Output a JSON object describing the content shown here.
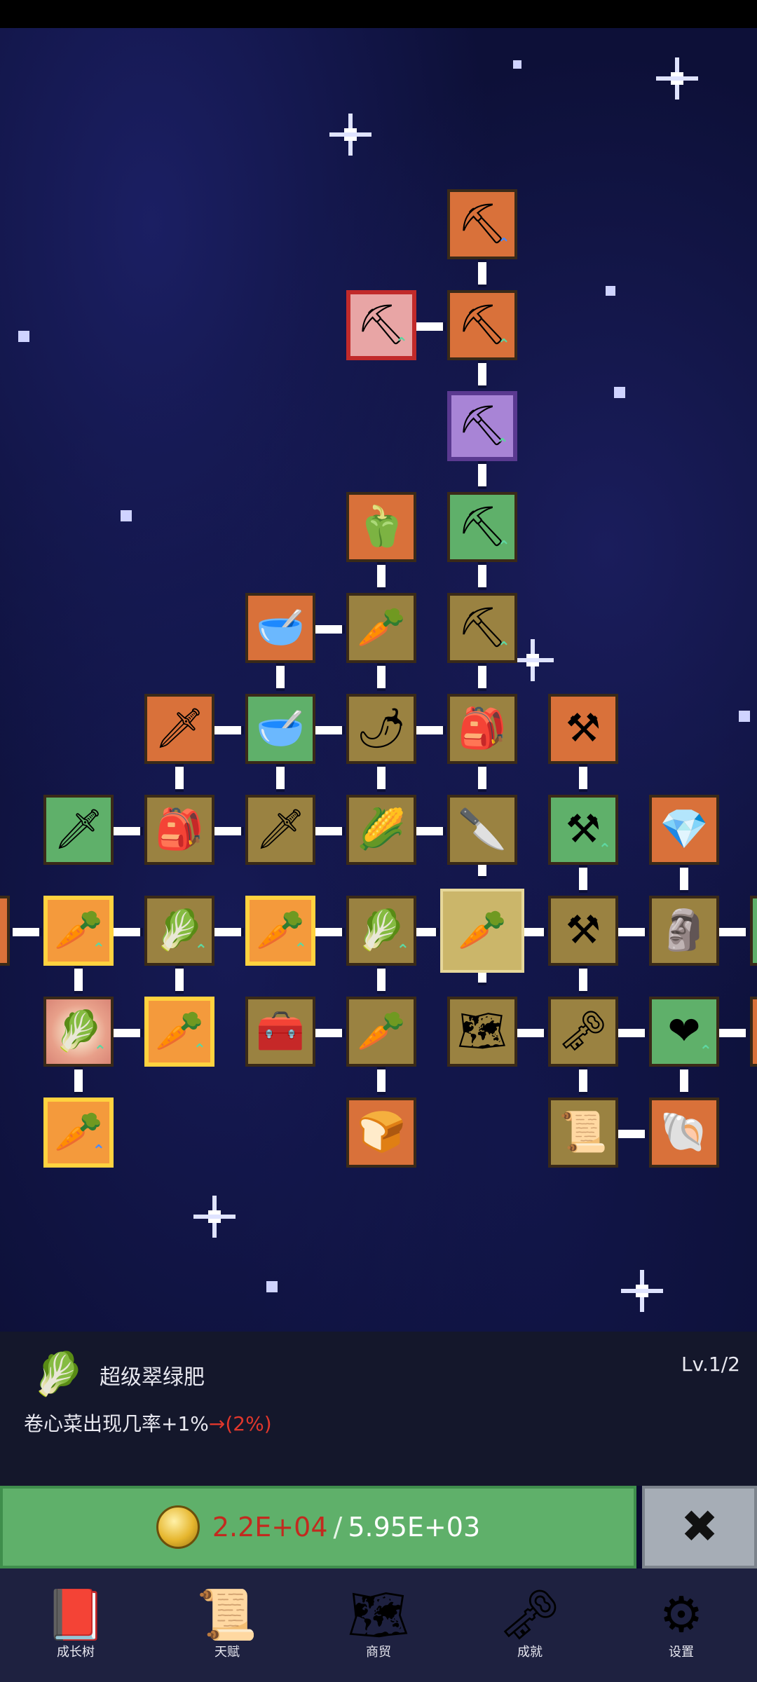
{
  "info": {
    "title": "超级翠绿肥",
    "level": "Lv.1/2",
    "desc_text": "卷心菜出现几率+1%",
    "desc_arrow": "→",
    "desc_after": "(2%)",
    "icon": "cabbage-icon"
  },
  "purchase": {
    "have": "2.2E+04",
    "separator": "/",
    "cost": "5.95E+03",
    "coin_icon": "gold-coin-icon",
    "close_icon": "close-x-icon"
  },
  "nav": {
    "items": [
      {
        "label": "成长树",
        "icon": "book-icon"
      },
      {
        "label": "天赋",
        "icon": "scroll-icon"
      },
      {
        "label": "商贸",
        "icon": "map-icon"
      },
      {
        "label": "成就",
        "icon": "key-icon"
      },
      {
        "label": "设置",
        "icon": "gear-icon"
      }
    ]
  },
  "colors": {
    "space_bg": "#0d1038",
    "buy_bar": "#5fb06a",
    "price_red": "#c22a1f",
    "node_orange": "#d9713a",
    "node_brown": "#9a8241",
    "node_green": "#5fb06a"
  }
}
